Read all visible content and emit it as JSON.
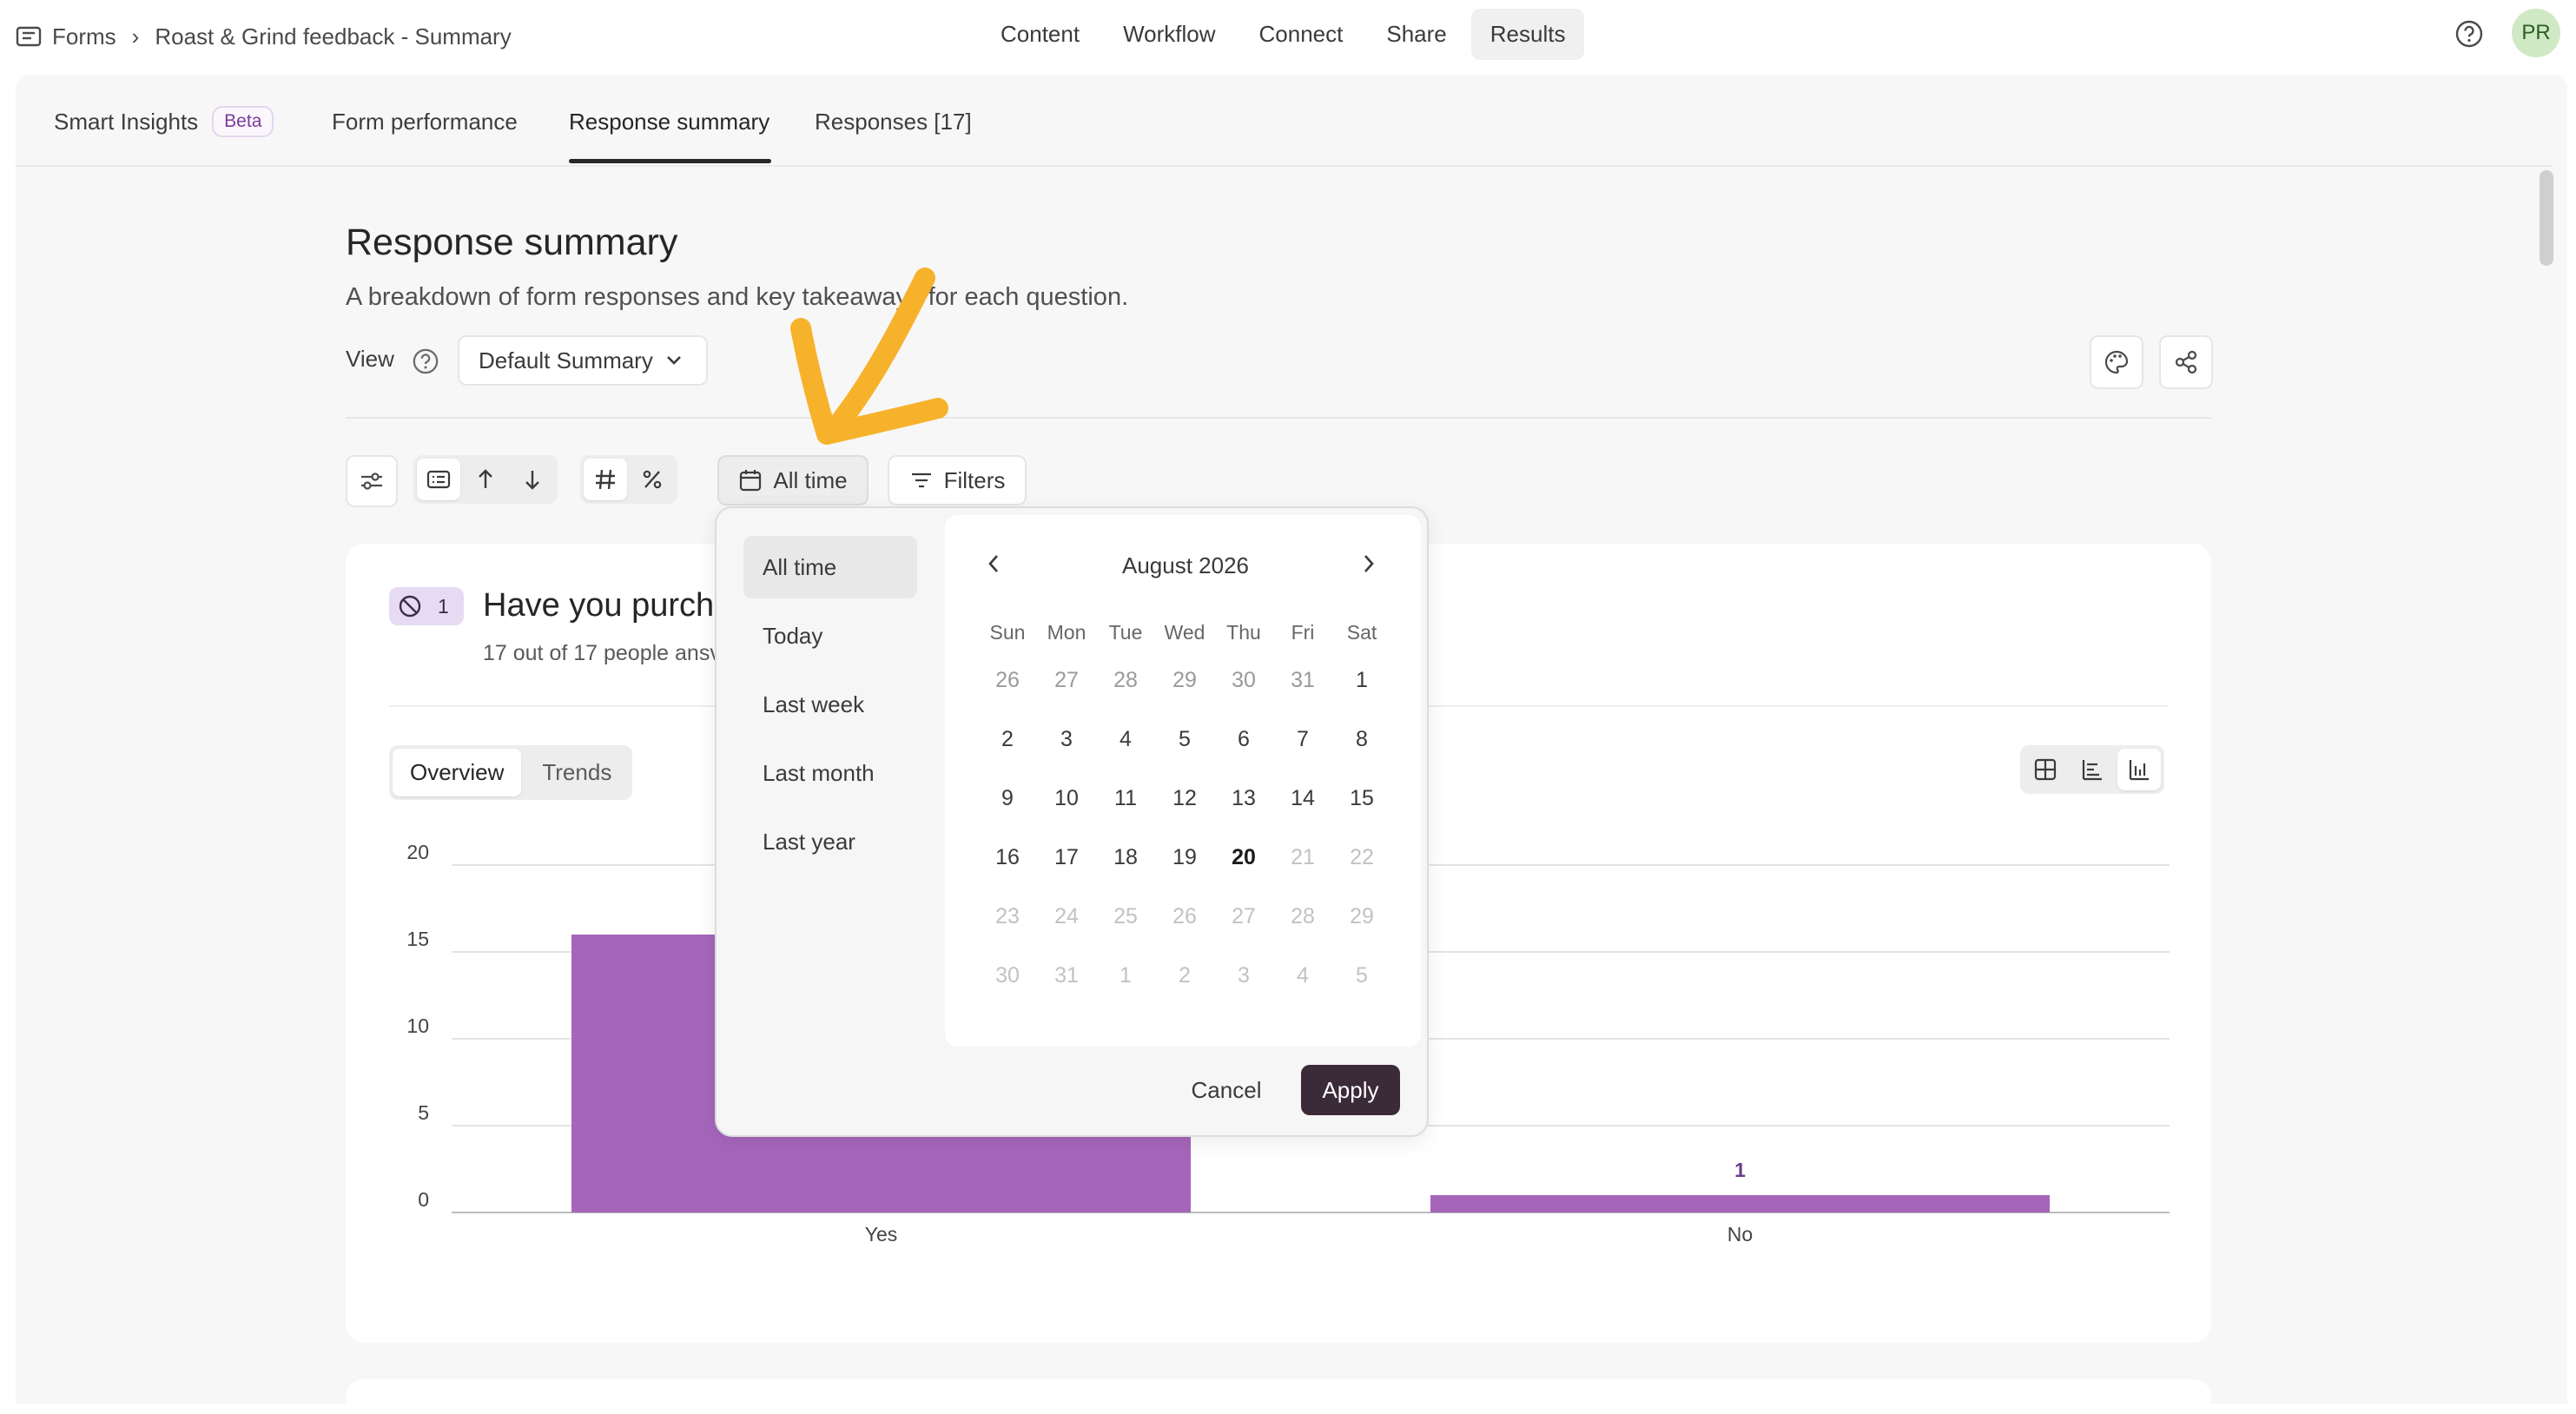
{
  "breadcrumb": {
    "root": "Forms",
    "sep": "›",
    "current": "Roast & Grind feedback - Summary"
  },
  "nav": {
    "tabs": [
      "Content",
      "Workflow",
      "Connect",
      "Share",
      "Results"
    ],
    "active": "Results"
  },
  "user": {
    "initials": "PR"
  },
  "subtabs": {
    "smart_insights": "Smart Insights",
    "beta": "Beta",
    "form_performance": "Form performance",
    "response_summary": "Response summary",
    "responses": "Responses [17]"
  },
  "page": {
    "title": "Response summary",
    "description": "A breakdown of form responses and key takeaways for each question.",
    "view_label": "View",
    "view_value": "Default Summary"
  },
  "toolbar": {
    "date_label": "All time",
    "filters_label": "Filters"
  },
  "question": {
    "number": "1",
    "title": "Have you purcha",
    "subtitle": "17 out of 17 people ansv",
    "tabs": [
      "Overview",
      "Trends"
    ],
    "active_tab": "Overview"
  },
  "chart_data": {
    "type": "bar",
    "categories": [
      "Yes",
      "No"
    ],
    "values": [
      16,
      1
    ],
    "data_labels": [
      "",
      "1"
    ],
    "yticks": [
      "20",
      "15",
      "10",
      "5",
      "0"
    ],
    "ylim": [
      0,
      20
    ],
    "grid": true,
    "bar_color": "#a566ba"
  },
  "date_picker": {
    "presets": [
      "All time",
      "Today",
      "Last week",
      "Last month",
      "Last year"
    ],
    "selected_preset": "All time",
    "month_label": "August 2026",
    "weekdays": [
      "Sun",
      "Mon",
      "Tue",
      "Wed",
      "Thu",
      "Fri",
      "Sat"
    ],
    "weeks": [
      [
        "26",
        "27",
        "28",
        "29",
        "30",
        "31",
        "1"
      ],
      [
        "2",
        "3",
        "4",
        "5",
        "6",
        "7",
        "8"
      ],
      [
        "9",
        "10",
        "11",
        "12",
        "13",
        "14",
        "15"
      ],
      [
        "16",
        "17",
        "18",
        "19",
        "20",
        "21",
        "22"
      ],
      [
        "23",
        "24",
        "25",
        "26",
        "27",
        "28",
        "29"
      ],
      [
        "30",
        "31",
        "1",
        "2",
        "3",
        "4",
        "5"
      ]
    ],
    "today": "20",
    "cancel": "Cancel",
    "apply": "Apply"
  },
  "colors": {
    "accent_bar": "#a566ba",
    "apply_bg": "#3b2a38",
    "arrow": "#f7b22c",
    "avatar_bg": "#cfe9c4"
  }
}
